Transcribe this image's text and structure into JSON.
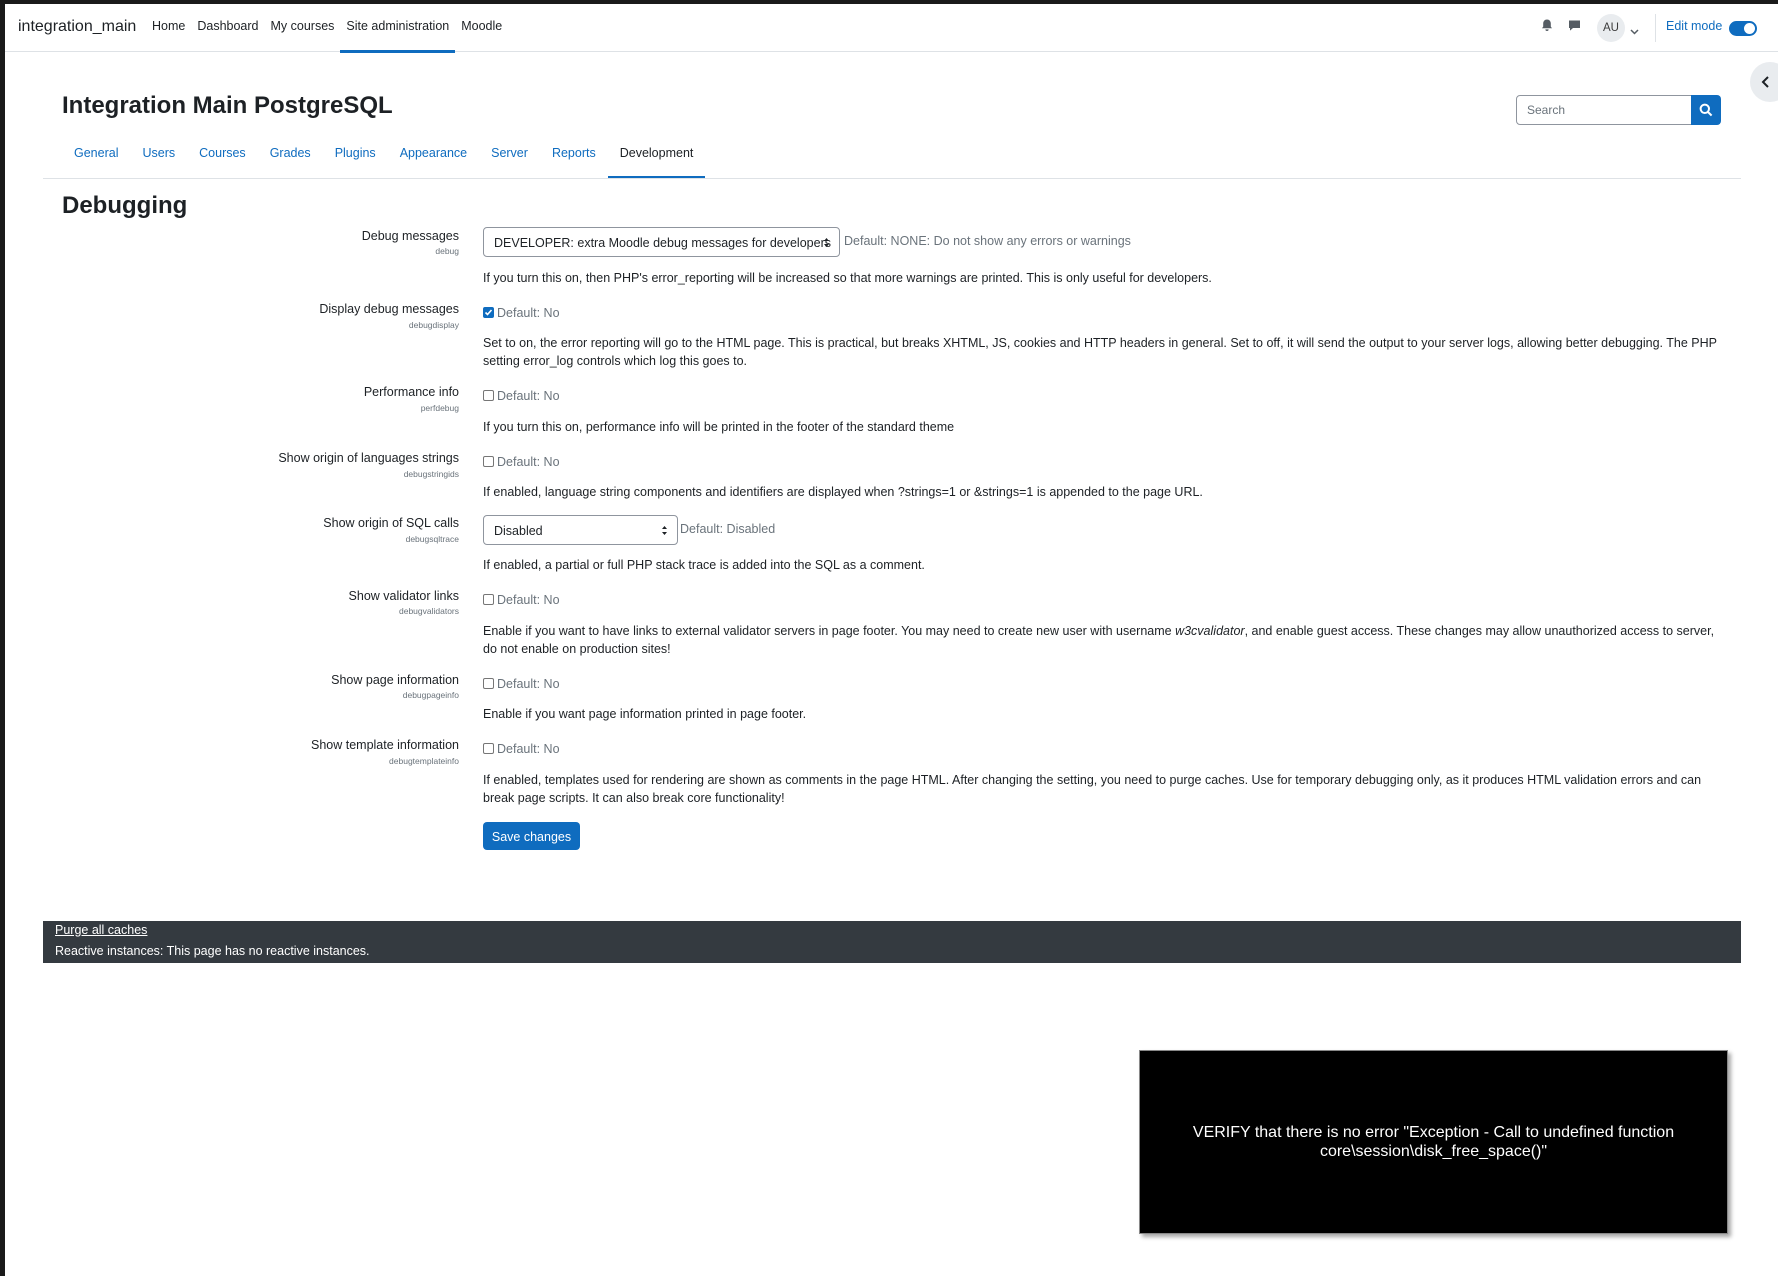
{
  "navbar": {
    "brand": "integration_main",
    "items": [
      "Home",
      "Dashboard",
      "My courses",
      "Site administration",
      "Moodle"
    ],
    "active_index": 3,
    "avatar_initials": "AU",
    "edit_mode_label": "Edit mode",
    "edit_mode_on": true
  },
  "header": {
    "title": "Integration Main PostgreSQL",
    "search_placeholder": "Search"
  },
  "tabs": {
    "items": [
      "General",
      "Users",
      "Courses",
      "Grades",
      "Plugins",
      "Appearance",
      "Server",
      "Reports",
      "Development"
    ],
    "active_index": 8
  },
  "section": {
    "title": "Debugging"
  },
  "settings": {
    "debug": {
      "label": "Debug messages",
      "key": "debug",
      "value": "DEVELOPER: extra Moodle debug messages for developers",
      "default": "Default: NONE: Do not show any errors or warnings",
      "description": "If you turn this on, then PHP's error_reporting will be increased so that more warnings are printed. This is only useful for developers."
    },
    "debugdisplay": {
      "label": "Display debug messages",
      "key": "debugdisplay",
      "checked": true,
      "default": "Default: No",
      "description": "Set to on, the error reporting will go to the HTML page. This is practical, but breaks XHTML, JS, cookies and HTTP headers in general. Set to off, it will send the output to your server logs, allowing better debugging. The PHP setting error_log controls which log this goes to."
    },
    "perfdebug": {
      "label": "Performance info",
      "key": "perfdebug",
      "checked": false,
      "default": "Default: No",
      "description": "If you turn this on, performance info will be printed in the footer of the standard theme"
    },
    "debugstringids": {
      "label": "Show origin of languages strings",
      "key": "debugstringids",
      "checked": false,
      "default": "Default: No",
      "description": "If enabled, language string components and identifiers are displayed when ?strings=1 or &strings=1 is appended to the page URL."
    },
    "debugsqltrace": {
      "label": "Show origin of SQL calls",
      "key": "debugsqltrace",
      "value": "Disabled",
      "default": "Default: Disabled",
      "description": "If enabled, a partial or full PHP stack trace is added into the SQL as a comment."
    },
    "debugvalidators": {
      "label": "Show validator links",
      "key": "debugvalidators",
      "checked": false,
      "default": "Default: No",
      "description_pre": "Enable if you want to have links to external validator servers in page footer. You may need to create new user with username ",
      "description_em": "w3cvalidator",
      "description_post": ", and enable guest access. These changes may allow unauthorized access to server, do not enable on production sites!"
    },
    "debugpageinfo": {
      "label": "Show page information",
      "key": "debugpageinfo",
      "checked": false,
      "default": "Default: No",
      "description": "Enable if you want page information printed in page footer."
    },
    "debugtemplateinfo": {
      "label": "Show template information",
      "key": "debugtemplateinfo",
      "checked": false,
      "default": "Default: No",
      "description": "If enabled, templates used for rendering are shown as comments in the page HTML. After changing the setting, you need to purge caches. Use for temporary debugging only, as it produces HTML validation errors and can break page scripts. It can also break core functionality!"
    }
  },
  "actions": {
    "save_label": "Save changes"
  },
  "footer": {
    "purge_label": "Purge all caches",
    "reactive_text": "Reactive instances: This page has no reactive instances."
  },
  "overlay": {
    "text": "VERIFY that there is no error \"Exception - Call to undefined function core\\session\\disk_free_space()\""
  },
  "colors": {
    "primary": "#0f6cbf",
    "footer_bg": "#343a40",
    "text": "#1d2125",
    "muted": "#6a737b"
  },
  "icons": [
    "bell-icon",
    "chat-icon",
    "chevron-down-icon",
    "chevron-left-icon",
    "search-icon",
    "check-icon"
  ]
}
